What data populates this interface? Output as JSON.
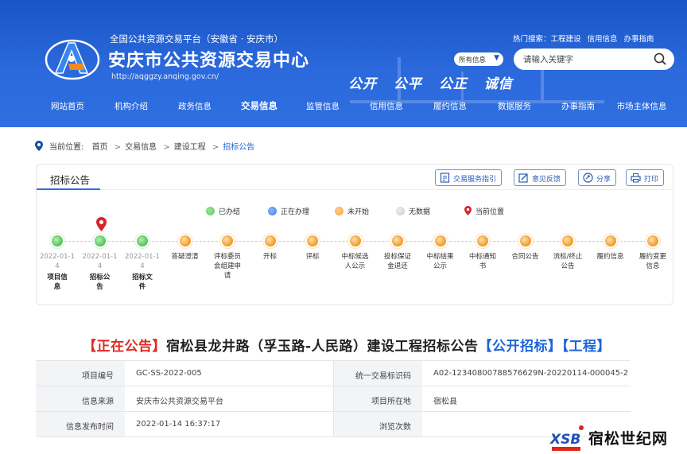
{
  "header": {
    "platform_line": "全国公共资源交易平台（安徽省 · 安庆市）",
    "site_title": "安庆市公共资源交易中心",
    "site_url": "http://aqggzy.anqing.gov.cn/",
    "core_values": [
      "公开",
      "公平",
      "公正",
      "诚信"
    ],
    "hot_search_label": "热门搜索：",
    "hot_search_items": [
      "工程建设",
      "信用信息",
      "办事指南"
    ],
    "search_scope": "所有信息",
    "search_placeholder": "请输入关键字",
    "nav": [
      "网站首页",
      "机构介绍",
      "政务信息",
      "交易信息",
      "监管信息",
      "信用信息",
      "履约信息",
      "数据服务",
      "办事指南",
      "市场主体信息"
    ],
    "active_nav": "交易信息"
  },
  "breadcrumb": {
    "label": "当前位置:",
    "items": [
      "首页",
      "交易信息",
      "建设工程",
      "招标公告"
    ],
    "separator": ">"
  },
  "panel": {
    "title": "招标公告",
    "buttons": [
      "交易服务指引",
      "意见反馈",
      "分享",
      "打印"
    ],
    "legend": [
      {
        "label": "已办结",
        "color": "#5cc85c"
      },
      {
        "label": "正在办理",
        "color": "#3a7be0"
      },
      {
        "label": "未开始",
        "color": "#f5a030"
      },
      {
        "label": "无数据",
        "color": "#c8c8c8"
      },
      {
        "label": "当前位置",
        "color": "#d9232b"
      }
    ],
    "steps": [
      {
        "name": "项目信息",
        "date": "2022-01-14",
        "status": "done"
      },
      {
        "name": "招标公告",
        "date": "2022-01-14",
        "status": "done"
      },
      {
        "name": "招标文件",
        "date": "2022-01-14",
        "status": "done"
      },
      {
        "name": "答疑澄清",
        "date": "",
        "status": "pending"
      },
      {
        "name": "评标委员会组建申请",
        "date": "",
        "status": "pending"
      },
      {
        "name": "开标",
        "date": "",
        "status": "pending"
      },
      {
        "name": "评标",
        "date": "",
        "status": "pending"
      },
      {
        "name": "中标候选人公示",
        "date": "",
        "status": "pending"
      },
      {
        "name": "投标保证金退还",
        "date": "",
        "status": "pending"
      },
      {
        "name": "中标结果公示",
        "date": "",
        "status": "pending"
      },
      {
        "name": "中标通知书",
        "date": "",
        "status": "pending"
      },
      {
        "name": "合同公告",
        "date": "",
        "status": "pending"
      },
      {
        "name": "流标/终止公告",
        "date": "",
        "status": "pending"
      },
      {
        "name": "履约信息",
        "date": "",
        "status": "pending"
      },
      {
        "name": "履约变更信息",
        "date": "",
        "status": "pending"
      }
    ],
    "current_step": "招标公告"
  },
  "notice": {
    "status_tag": "【正在公告】",
    "title": "宿松县龙井路（孚玉路-人民路）建设工程招标公告",
    "type_tag": "【公开招标】",
    "category_tag": "【工程】"
  },
  "info_table": [
    {
      "k1": "项目编号",
      "v1": "GC-SS-2022-005",
      "k2": "统一交易标识码",
      "v2": "A02-12340800788576629N-20220114-000045-2"
    },
    {
      "k1": "信息来源",
      "v1": "安庆市公共资源交易平台",
      "k2": "项目所在地",
      "v2": "宿松县"
    },
    {
      "k1": "信息发布时间",
      "v1": "2022-01-14 16:37:17",
      "k2": "浏览次数",
      "v2": ""
    }
  ],
  "watermark": {
    "logo_letters": "XSB",
    "text": "宿松世纪网"
  },
  "colors": {
    "header_blue": "#2b69dc",
    "accent_blue": "#1c64d8",
    "status_red": "#e02b20",
    "done_green": "#5cc85c",
    "pending_orange": "#f5a030"
  }
}
